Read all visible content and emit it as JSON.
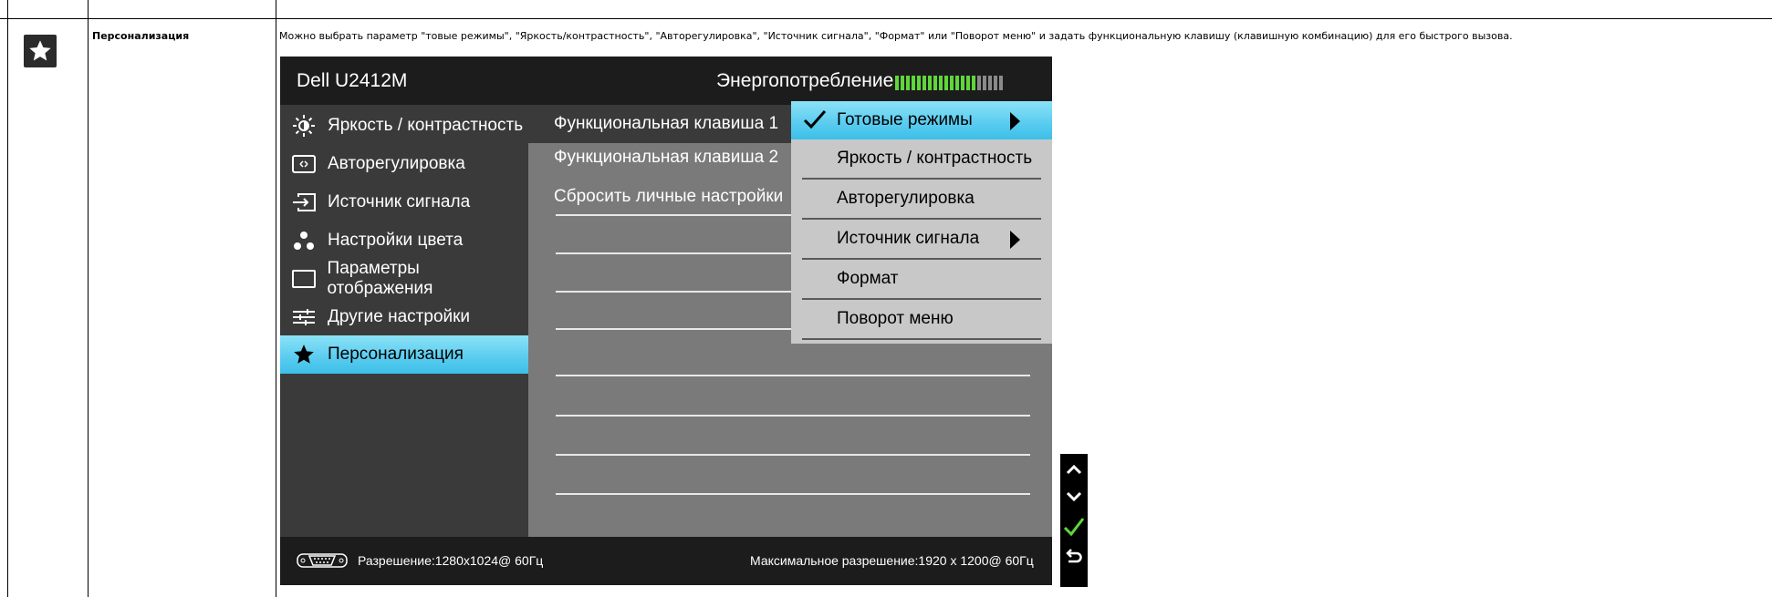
{
  "row": {
    "icon": "star-icon",
    "name": "Персонализация",
    "description": "Можно выбрать параметр \"товые режимы\", \"Яркость/контрастность\", \"Авторегулировка\", \"Источник сигнала\", \"Формат\" или \"Поворот меню\" и задать функциональную клавишу (клавишную комбинацию) для его быстрого вызова."
  },
  "osd": {
    "model": "Dell U2412M",
    "energy_label": "Энергопотребление",
    "energy_level": "15 of 20 segments lit",
    "colors": {
      "accent": "#4cc8ef",
      "energy_on": "#5fd63a",
      "energy_off": "#8a8a8a"
    },
    "menu": [
      {
        "label": "Яркость / контрастность",
        "icon": "brightness-icon"
      },
      {
        "label": "Авторегулировка",
        "icon": "auto-adjust-icon"
      },
      {
        "label": "Источник сигнала",
        "icon": "input-source-icon"
      },
      {
        "label": "Настройки цвета",
        "icon": "color-settings-icon"
      },
      {
        "label": "Параметры отображения",
        "icon": "display-settings-icon"
      },
      {
        "label": "Другие настройки",
        "icon": "other-settings-icon"
      },
      {
        "label": "Персонализация",
        "icon": "star-icon",
        "selected": true
      }
    ],
    "submenu": [
      {
        "label": "Функциональная клавиша 1",
        "selected": true
      },
      {
        "label": "Функциональная клавиша 2"
      },
      {
        "label": "Сбросить личные настройки"
      }
    ],
    "popup": [
      {
        "label": "Готовые режимы",
        "checked": true,
        "has_arrow": true
      },
      {
        "label": "Яркость / контрастность"
      },
      {
        "label": "Авторегулировка"
      },
      {
        "label": "Источник сигнала",
        "has_arrow": true
      },
      {
        "label": "Формат"
      },
      {
        "label": "Поворот меню"
      }
    ],
    "footer": {
      "resolution": "Разрешение:1280x1024@ 60Гц",
      "max_resolution": "Максимальное разрешение:1920 x 1200@ 60Гц"
    }
  },
  "side_buttons": [
    "up-icon",
    "down-icon",
    "check-icon",
    "back-icon"
  ]
}
